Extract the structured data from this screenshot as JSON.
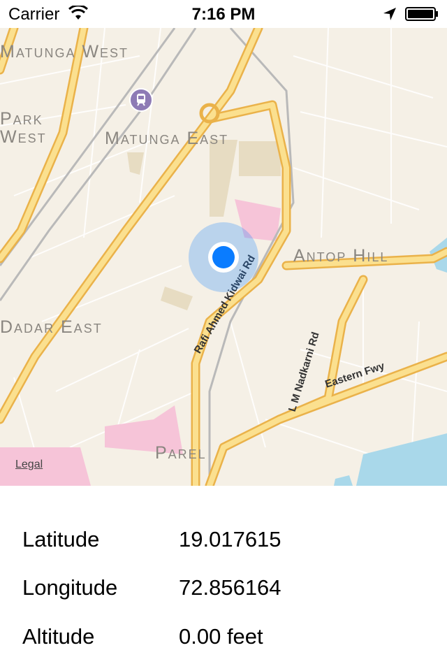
{
  "status_bar": {
    "carrier": "Carrier",
    "time": "7:16 PM",
    "wifi_icon": "wifi-icon",
    "location_icon": "location-arrow-icon",
    "battery_icon": "battery-icon"
  },
  "map": {
    "neighborhoods": {
      "matunga_west": "Matunga West",
      "park_west_1": "Park",
      "park_west_2": "West",
      "matunga_east": "Matunga East",
      "antop_hill": "Antop Hill",
      "dadar_east": "Dadar East",
      "parel": "Parel"
    },
    "roads": {
      "rafi_ahmed_kidwai": "Rafi Ahmed Kidwai Rd",
      "lm_nadkarni": "L M Nadkarni Rd",
      "eastern_fwy": "Eastern Fwy"
    },
    "legal": "Legal",
    "colors": {
      "land": "#f5f0e6",
      "major_road": "#f6c95a",
      "water": "#a9d8ea",
      "pink_zone": "#f6c4d8",
      "tan_zone": "#e7dcc2",
      "user_dot": "#0a7cff"
    }
  },
  "info": {
    "latitude_label": "Latitude",
    "latitude_value": "19.017615",
    "longitude_label": "Longitude",
    "longitude_value": "72.856164",
    "altitude_label": "Altitude",
    "altitude_value": "0.00 feet"
  }
}
